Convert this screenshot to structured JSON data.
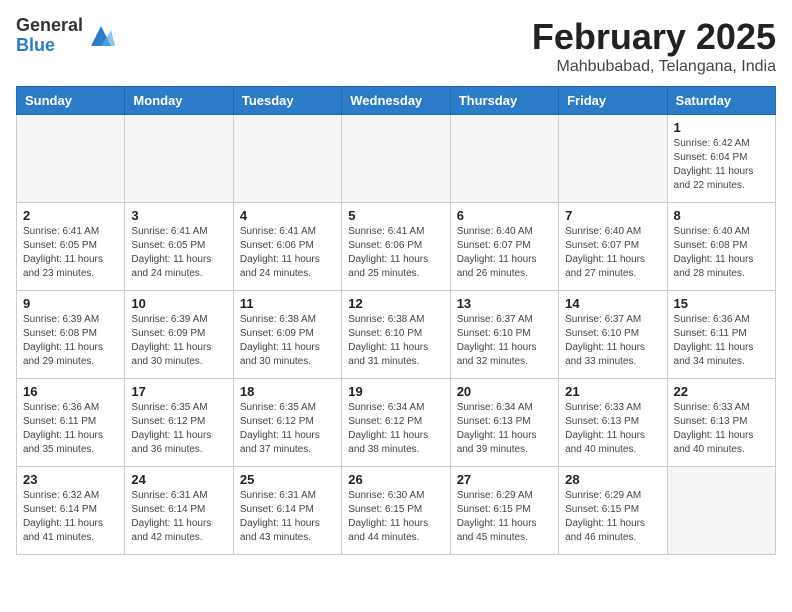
{
  "header": {
    "logo_general": "General",
    "logo_blue": "Blue",
    "main_title": "February 2025",
    "subtitle": "Mahbubabad, Telangana, India"
  },
  "weekdays": [
    "Sunday",
    "Monday",
    "Tuesday",
    "Wednesday",
    "Thursday",
    "Friday",
    "Saturday"
  ],
  "weeks": [
    [
      {
        "day": "",
        "info": ""
      },
      {
        "day": "",
        "info": ""
      },
      {
        "day": "",
        "info": ""
      },
      {
        "day": "",
        "info": ""
      },
      {
        "day": "",
        "info": ""
      },
      {
        "day": "",
        "info": ""
      },
      {
        "day": "1",
        "info": "Sunrise: 6:42 AM\nSunset: 6:04 PM\nDaylight: 11 hours\nand 22 minutes."
      }
    ],
    [
      {
        "day": "2",
        "info": "Sunrise: 6:41 AM\nSunset: 6:05 PM\nDaylight: 11 hours\nand 23 minutes."
      },
      {
        "day": "3",
        "info": "Sunrise: 6:41 AM\nSunset: 6:05 PM\nDaylight: 11 hours\nand 24 minutes."
      },
      {
        "day": "4",
        "info": "Sunrise: 6:41 AM\nSunset: 6:06 PM\nDaylight: 11 hours\nand 24 minutes."
      },
      {
        "day": "5",
        "info": "Sunrise: 6:41 AM\nSunset: 6:06 PM\nDaylight: 11 hours\nand 25 minutes."
      },
      {
        "day": "6",
        "info": "Sunrise: 6:40 AM\nSunset: 6:07 PM\nDaylight: 11 hours\nand 26 minutes."
      },
      {
        "day": "7",
        "info": "Sunrise: 6:40 AM\nSunset: 6:07 PM\nDaylight: 11 hours\nand 27 minutes."
      },
      {
        "day": "8",
        "info": "Sunrise: 6:40 AM\nSunset: 6:08 PM\nDaylight: 11 hours\nand 28 minutes."
      }
    ],
    [
      {
        "day": "9",
        "info": "Sunrise: 6:39 AM\nSunset: 6:08 PM\nDaylight: 11 hours\nand 29 minutes."
      },
      {
        "day": "10",
        "info": "Sunrise: 6:39 AM\nSunset: 6:09 PM\nDaylight: 11 hours\nand 30 minutes."
      },
      {
        "day": "11",
        "info": "Sunrise: 6:38 AM\nSunset: 6:09 PM\nDaylight: 11 hours\nand 30 minutes."
      },
      {
        "day": "12",
        "info": "Sunrise: 6:38 AM\nSunset: 6:10 PM\nDaylight: 11 hours\nand 31 minutes."
      },
      {
        "day": "13",
        "info": "Sunrise: 6:37 AM\nSunset: 6:10 PM\nDaylight: 11 hours\nand 32 minutes."
      },
      {
        "day": "14",
        "info": "Sunrise: 6:37 AM\nSunset: 6:10 PM\nDaylight: 11 hours\nand 33 minutes."
      },
      {
        "day": "15",
        "info": "Sunrise: 6:36 AM\nSunset: 6:11 PM\nDaylight: 11 hours\nand 34 minutes."
      }
    ],
    [
      {
        "day": "16",
        "info": "Sunrise: 6:36 AM\nSunset: 6:11 PM\nDaylight: 11 hours\nand 35 minutes."
      },
      {
        "day": "17",
        "info": "Sunrise: 6:35 AM\nSunset: 6:12 PM\nDaylight: 11 hours\nand 36 minutes."
      },
      {
        "day": "18",
        "info": "Sunrise: 6:35 AM\nSunset: 6:12 PM\nDaylight: 11 hours\nand 37 minutes."
      },
      {
        "day": "19",
        "info": "Sunrise: 6:34 AM\nSunset: 6:12 PM\nDaylight: 11 hours\nand 38 minutes."
      },
      {
        "day": "20",
        "info": "Sunrise: 6:34 AM\nSunset: 6:13 PM\nDaylight: 11 hours\nand 39 minutes."
      },
      {
        "day": "21",
        "info": "Sunrise: 6:33 AM\nSunset: 6:13 PM\nDaylight: 11 hours\nand 40 minutes."
      },
      {
        "day": "22",
        "info": "Sunrise: 6:33 AM\nSunset: 6:13 PM\nDaylight: 11 hours\nand 40 minutes."
      }
    ],
    [
      {
        "day": "23",
        "info": "Sunrise: 6:32 AM\nSunset: 6:14 PM\nDaylight: 11 hours\nand 41 minutes."
      },
      {
        "day": "24",
        "info": "Sunrise: 6:31 AM\nSunset: 6:14 PM\nDaylight: 11 hours\nand 42 minutes."
      },
      {
        "day": "25",
        "info": "Sunrise: 6:31 AM\nSunset: 6:14 PM\nDaylight: 11 hours\nand 43 minutes."
      },
      {
        "day": "26",
        "info": "Sunrise: 6:30 AM\nSunset: 6:15 PM\nDaylight: 11 hours\nand 44 minutes."
      },
      {
        "day": "27",
        "info": "Sunrise: 6:29 AM\nSunset: 6:15 PM\nDaylight: 11 hours\nand 45 minutes."
      },
      {
        "day": "28",
        "info": "Sunrise: 6:29 AM\nSunset: 6:15 PM\nDaylight: 11 hours\nand 46 minutes."
      },
      {
        "day": "",
        "info": ""
      }
    ]
  ]
}
